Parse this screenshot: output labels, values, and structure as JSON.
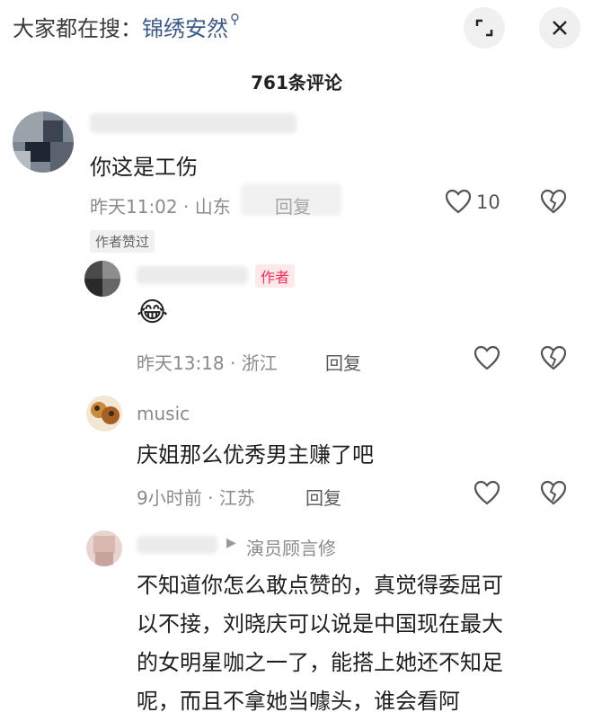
{
  "header": {
    "search_prefix": "大家都在搜：",
    "search_term": "锦绣安然",
    "search_icon": "search-icon",
    "expand_icon": "expand-icon",
    "close_icon": "close-icon",
    "title": "761条评论"
  },
  "comments": [
    {
      "content": "你这是工伤",
      "time": "昨天11:02",
      "location": "山东",
      "reply_label": "回复",
      "likes": "10",
      "liked_badge": "作者赞过"
    },
    {
      "author_tag": "作者",
      "emoji": "😂",
      "time": "昨天13:18",
      "location": "浙江",
      "reply_label": "回复"
    },
    {
      "username": "music",
      "content": "庆姐那么优秀男主赚了吧",
      "time": "9小时前",
      "location": "江苏",
      "reply_label": "回复"
    },
    {
      "reply_to": "演员顾言修",
      "lines": [
        "不知道你怎么敢点赞的，真觉得委屈可",
        "以不接，刘晓庆可以说是中国现在最大",
        "的女明星咖之一了，能搭上她还不知足",
        "呢，而且不拿她当噱头，谁会看阿"
      ]
    }
  ],
  "colors": {
    "accent": "#fe2c55",
    "link": "#3b5a8a",
    "meta": "#8a8a8a"
  }
}
